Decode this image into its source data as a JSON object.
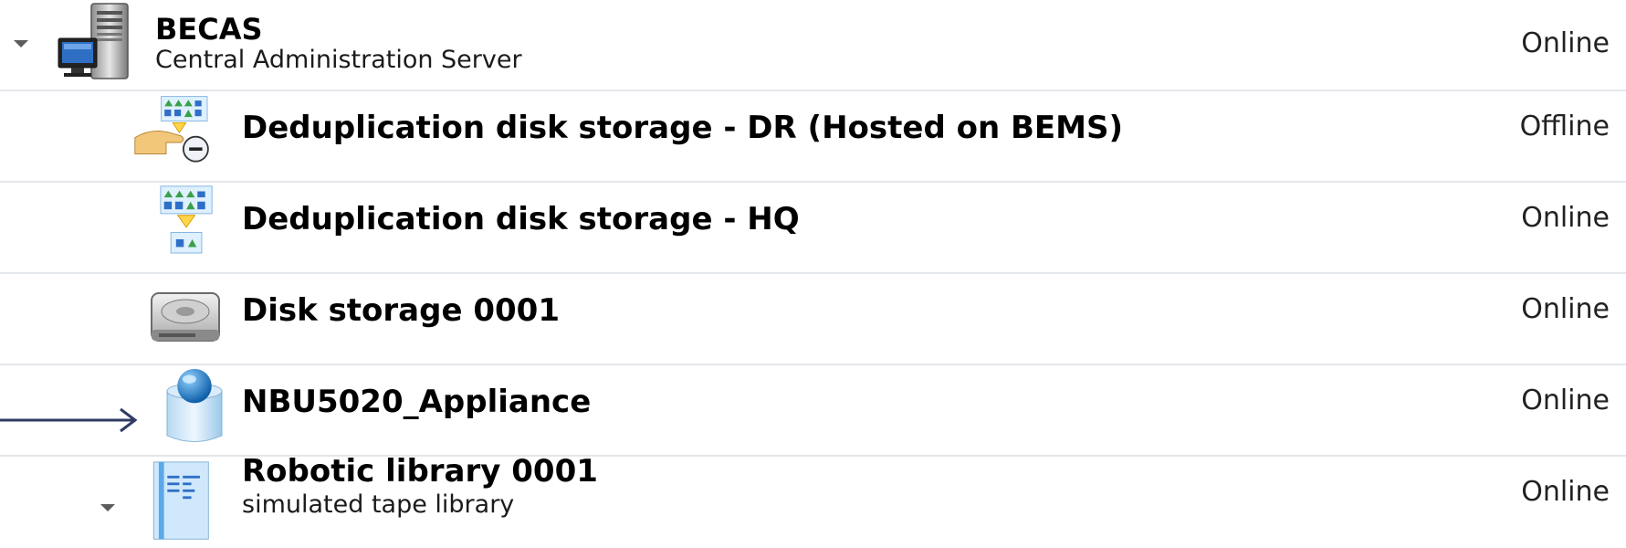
{
  "tree": {
    "items": [
      {
        "title": "BECAS",
        "subtitle": "Central Administration Server",
        "status": "Online",
        "icon": "server-icon",
        "expanded": true
      },
      {
        "title": "Deduplication disk storage - DR (Hosted on BEMS)",
        "status": "Offline",
        "icon": "deduplication-storage-offline-icon"
      },
      {
        "title": "Deduplication disk storage - HQ",
        "status": "Online",
        "icon": "deduplication-storage-icon"
      },
      {
        "title": "Disk storage 0001",
        "status": "Online",
        "icon": "hard-disk-icon"
      },
      {
        "title": "NBU5020_Appliance",
        "status": "Online",
        "icon": "appliance-icon"
      },
      {
        "title": "Robotic library 0001",
        "subtitle": "simulated tape library",
        "status": "Online",
        "icon": "tape-library-icon",
        "expanded": true
      }
    ]
  },
  "colors": {
    "row_divider": "#e3e7eb",
    "arrow": "#2f3b63"
  },
  "annotation": {
    "arrow_icon": "arrow-right-icon",
    "points_to": "NBU5020_Appliance"
  }
}
